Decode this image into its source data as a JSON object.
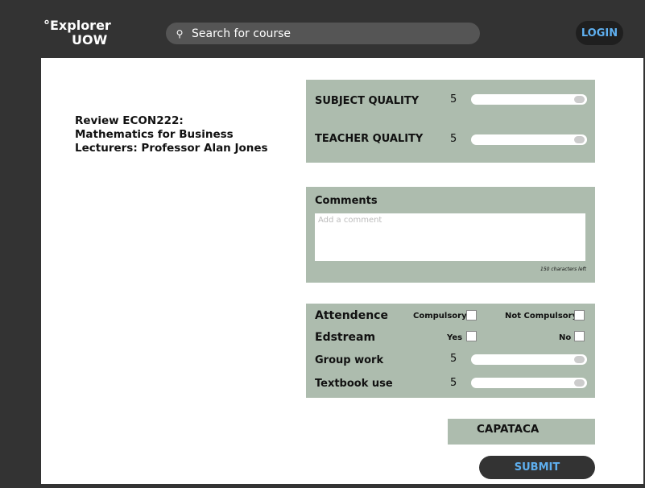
{
  "header": {
    "logo_line1": "°Explorer",
    "logo_line2": "UOW",
    "search_placeholder": "Search for course",
    "login_label": "LOGIN"
  },
  "review": {
    "line1": "Review ECON222:",
    "line2": "Mathematics for Business",
    "line3": "Lecturers: Professor Alan Jones"
  },
  "quality": {
    "subject_label": "SUBJECT QUALITY",
    "subject_value": "5",
    "teacher_label": "TEACHER QUALITY",
    "teacher_value": "5"
  },
  "comments": {
    "title": "Comments",
    "placeholder": "Add a comment",
    "char_count": "150 characters left"
  },
  "details": {
    "attendence_label": "Attendence",
    "compulsory_label": "Compulsory",
    "not_compulsory_label": "Not Compulsory",
    "edstream_label": "Edstream",
    "yes_label": "Yes",
    "no_label": "No",
    "group_work_label": "Group work",
    "group_work_value": "5",
    "textbook_label": "Textbook use",
    "textbook_value": "5"
  },
  "captcha": {
    "text": "CAPATACA"
  },
  "submit_label": "SUBMIT",
  "colors": {
    "dark": "#333333",
    "panel": "#adbcae",
    "accent": "#5fb0f0"
  }
}
